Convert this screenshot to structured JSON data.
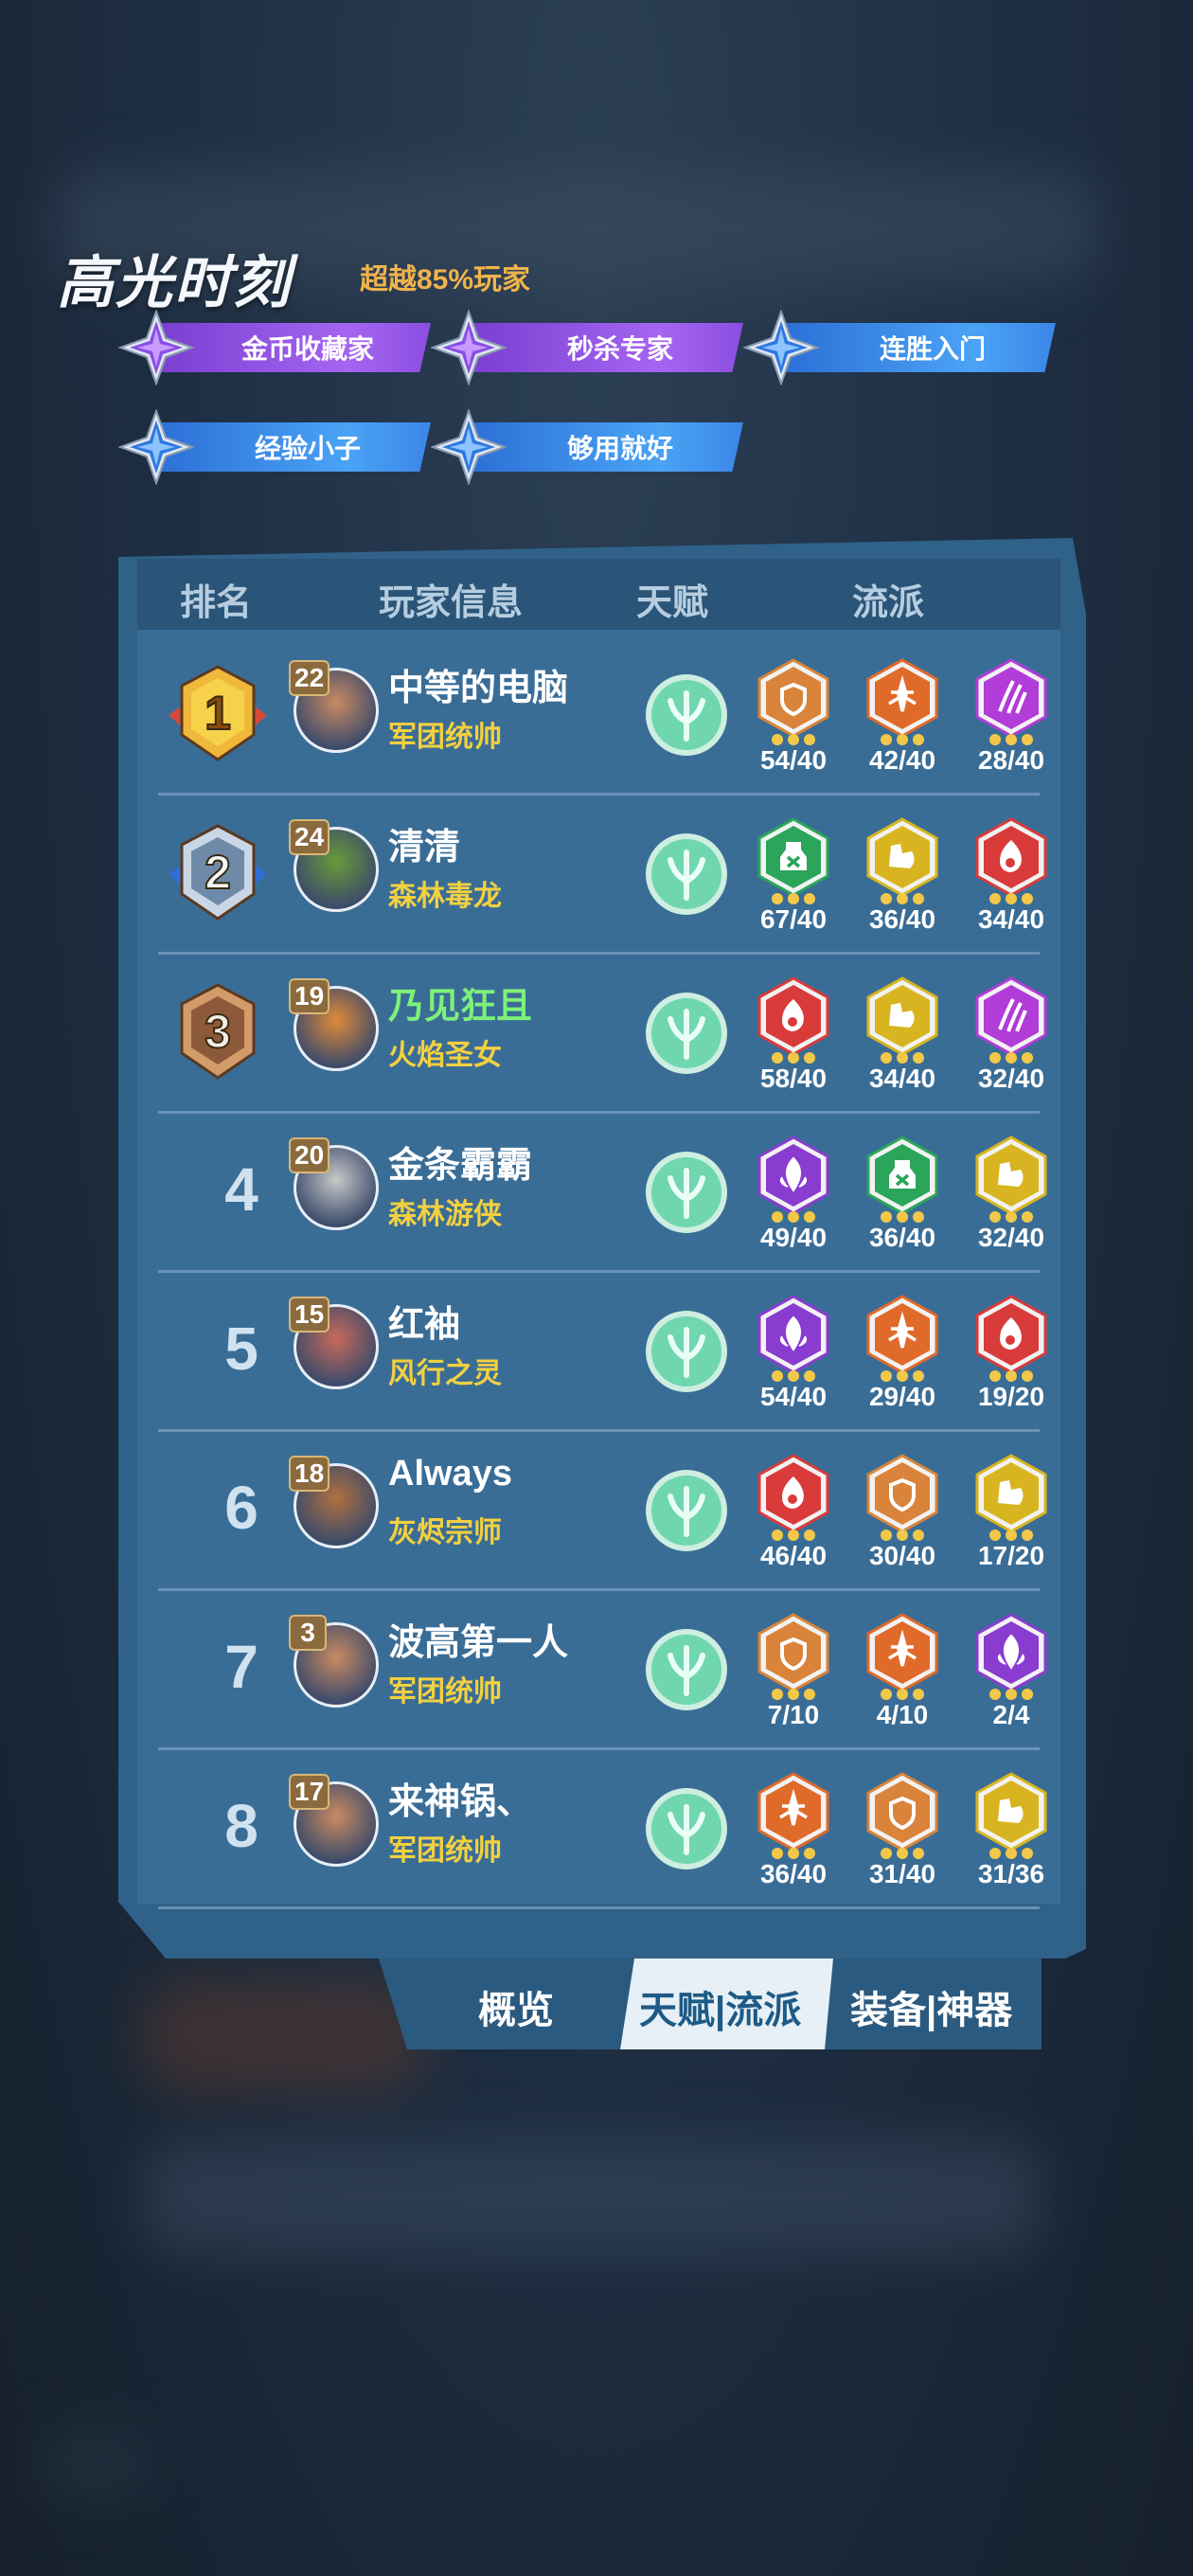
{
  "highlight": {
    "title": "高光时刻",
    "subtitle": "超越85%玩家",
    "badges": [
      {
        "label": "金币收藏家",
        "color": "purple"
      },
      {
        "label": "秒杀专家",
        "color": "purple"
      },
      {
        "label": "连胜入门",
        "color": "blue"
      },
      {
        "label": "经验小子",
        "color": "blue"
      },
      {
        "label": "够用就好",
        "color": "blue"
      }
    ]
  },
  "table": {
    "headers": {
      "rank": "排名",
      "player": "玩家信息",
      "talent": "天赋",
      "faction": "流派"
    },
    "rows": [
      {
        "rank": "1",
        "level": "22",
        "name": "中等的电脑",
        "class": "军团统帅",
        "traits": [
          {
            "icon": "shield-icon",
            "color": "#d9843a",
            "count": "54/40"
          },
          {
            "icon": "sword-icon",
            "color": "#e06a2a",
            "count": "42/40"
          },
          {
            "icon": "claw-icon",
            "color": "#b13cd8",
            "count": "28/40"
          }
        ]
      },
      {
        "rank": "2",
        "level": "24",
        "name": "清清",
        "class": "森林毒龙",
        "traits": [
          {
            "icon": "poison-icon",
            "color": "#2ba55a",
            "count": "67/40"
          },
          {
            "icon": "muscle-icon",
            "color": "#d8b520",
            "count": "36/40"
          },
          {
            "icon": "flame-icon",
            "color": "#d93b3b",
            "count": "34/40"
          }
        ]
      },
      {
        "rank": "3",
        "level": "19",
        "name": "乃见狂且",
        "class": "火焰圣女",
        "traits": [
          {
            "icon": "flame-icon",
            "color": "#d93b3b",
            "count": "58/40"
          },
          {
            "icon": "muscle-icon",
            "color": "#d8b520",
            "count": "34/40"
          },
          {
            "icon": "claw-icon",
            "color": "#b13cd8",
            "count": "32/40"
          }
        ]
      },
      {
        "rank": "4",
        "level": "20",
        "name": "金条霸霸",
        "class": "森林游侠",
        "traits": [
          {
            "icon": "leaf-icon",
            "color": "#8a3cd0",
            "count": "49/40"
          },
          {
            "icon": "poison-icon",
            "color": "#2ba55a",
            "count": "36/40"
          },
          {
            "icon": "muscle-icon",
            "color": "#d8b520",
            "count": "32/40"
          }
        ]
      },
      {
        "rank": "5",
        "level": "15",
        "name": "红袖",
        "class": "风行之灵",
        "traits": [
          {
            "icon": "leaf-icon",
            "color": "#8a3cd0",
            "count": "54/40"
          },
          {
            "icon": "sword-icon",
            "color": "#e06a2a",
            "count": "29/40"
          },
          {
            "icon": "flame-icon",
            "color": "#d93b3b",
            "count": "19/20"
          }
        ]
      },
      {
        "rank": "6",
        "level": "18",
        "name": "Always",
        "class": "灰烬宗师",
        "traits": [
          {
            "icon": "flame-icon",
            "color": "#d93b3b",
            "count": "46/40"
          },
          {
            "icon": "shield-icon",
            "color": "#d9843a",
            "count": "30/40"
          },
          {
            "icon": "muscle-icon",
            "color": "#d8b520",
            "count": "17/20"
          }
        ]
      },
      {
        "rank": "7",
        "level": "3",
        "name": "波高第一人",
        "class": "军团统帅",
        "traits": [
          {
            "icon": "shield-icon",
            "color": "#d9843a",
            "count": "7/10"
          },
          {
            "icon": "sword-icon",
            "color": "#e06a2a",
            "count": "4/10"
          },
          {
            "icon": "leaf-icon",
            "color": "#8a3cd0",
            "count": "2/4"
          }
        ]
      },
      {
        "rank": "8",
        "level": "17",
        "name": "来神锅、",
        "class": "军团统帅",
        "traits": [
          {
            "icon": "sword-icon",
            "color": "#e06a2a",
            "count": "36/40"
          },
          {
            "icon": "shield-icon",
            "color": "#d9843a",
            "count": "31/40"
          },
          {
            "icon": "muscle-icon",
            "color": "#d8b520",
            "count": "31/36"
          }
        ]
      }
    ]
  },
  "tabs": {
    "overview": "概览",
    "talent_faction": "天赋|流派",
    "equipment": "装备|神器",
    "active": "天赋|流派"
  },
  "colors": {
    "panel": "#3a6d96",
    "header": "#2a5478",
    "class_text": "#f2d040",
    "highlight_name": "#7df07a",
    "talent": "#6fd6b0"
  }
}
